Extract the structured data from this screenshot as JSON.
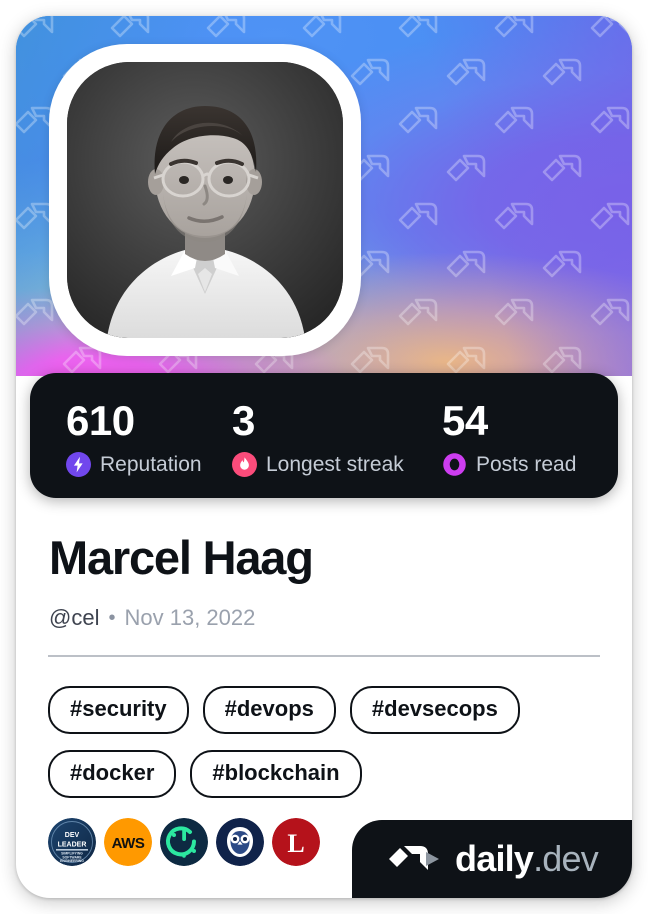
{
  "card": {
    "type": "devcard",
    "theme_colors": {
      "dark": "#0e1217",
      "reputation": "#7147ed",
      "streak": "#fb4c7b",
      "posts_read": "#cd3df0",
      "tag_border": "#0e1217",
      "divider": "#bcc0c7"
    }
  },
  "cover": {
    "watermark_icon": "daily-dev-logo-watermark"
  },
  "avatar": {
    "alt": "Marcel Haag profile photo",
    "style": "grayscale-portrait"
  },
  "stats": [
    {
      "id": "reputation",
      "value": "610",
      "label": "Reputation",
      "icon": "lightning-bolt-icon",
      "color": "#7147ed"
    },
    {
      "id": "longest-streak",
      "value": "3",
      "label": "Longest streak",
      "icon": "flame-icon",
      "color": "#fb4c7b"
    },
    {
      "id": "posts-read",
      "value": "54",
      "label": "Posts read",
      "icon": "eye-ring-icon",
      "color": "#cd3df0"
    }
  ],
  "profile": {
    "name": "Marcel Haag",
    "handle": "@cel",
    "separator": "•",
    "joined": "Nov 13, 2022"
  },
  "tags": [
    "#security",
    "#devops",
    "#devsecops",
    "#docker",
    "#blockchain"
  ],
  "badges": [
    {
      "id": "dev-leader",
      "name": "dev-leader-badge",
      "line1": "DEV",
      "line2": "LEADER",
      "line3": "SIMPLIFYING",
      "line4": "SOFTWARE",
      "line5": "ENGINEERING",
      "bg": "#17365c"
    },
    {
      "id": "aws",
      "name": "aws-badge",
      "label": "AWS",
      "bg": "#f90"
    },
    {
      "id": "cloud-native",
      "name": "cloud-native-badge",
      "bg": "#0d2a42",
      "fg": "#2ce8a0"
    },
    {
      "id": "owl",
      "name": "owl-badge",
      "bg": "#10234a",
      "fg": "#ffffff"
    },
    {
      "id": "l-badge",
      "name": "letter-l-badge",
      "label": "L",
      "bg": "#b5121b"
    }
  ],
  "brand": {
    "mark": "daily-dev-logo-mark",
    "name_white": "daily",
    "name_gray": ".dev"
  }
}
